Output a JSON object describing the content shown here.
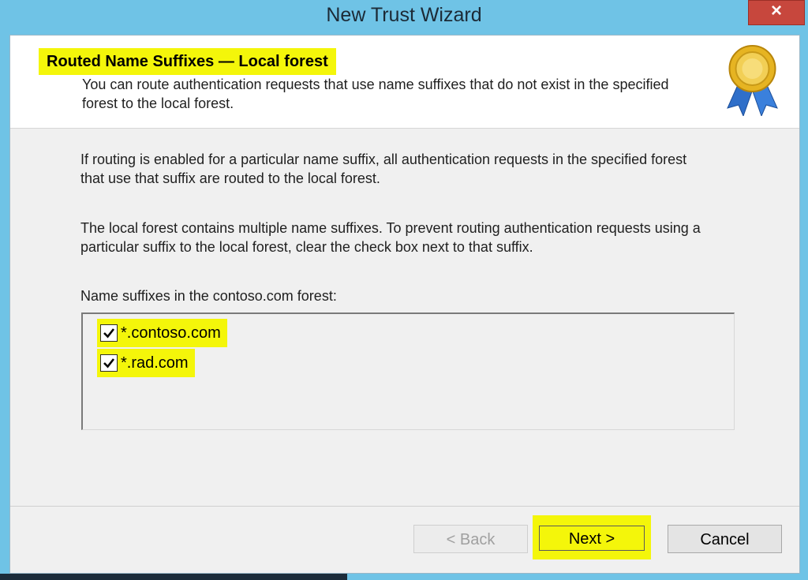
{
  "window": {
    "title": "New Trust Wizard",
    "close_glyph": "×"
  },
  "header": {
    "title": "Routed Name Suffixes — Local forest",
    "subtitle": "You can route authentication requests that use name suffixes that do not exist in the specified forest to the local forest.",
    "badge_icon": "award-ribbon-icon"
  },
  "body": {
    "paragraph1": "If routing is enabled for a particular name suffix, all authentication requests in the specified forest that use that suffix are routed to the local forest.",
    "paragraph2": "The local forest contains multiple name suffixes. To prevent routing authentication requests using a particular suffix to the local forest, clear the check box next to that suffix.",
    "list_label": "Name suffixes in the contoso.com forest:",
    "suffixes": [
      {
        "label": "*.contoso.com",
        "checked": true
      },
      {
        "label": "*.rad.com",
        "checked": true
      }
    ]
  },
  "buttons": {
    "back": "< Back",
    "next": "Next >",
    "cancel": "Cancel"
  },
  "colors": {
    "highlight": "#f4f60a",
    "window_frame": "#6fc3e6",
    "close_red": "#c7473d"
  }
}
